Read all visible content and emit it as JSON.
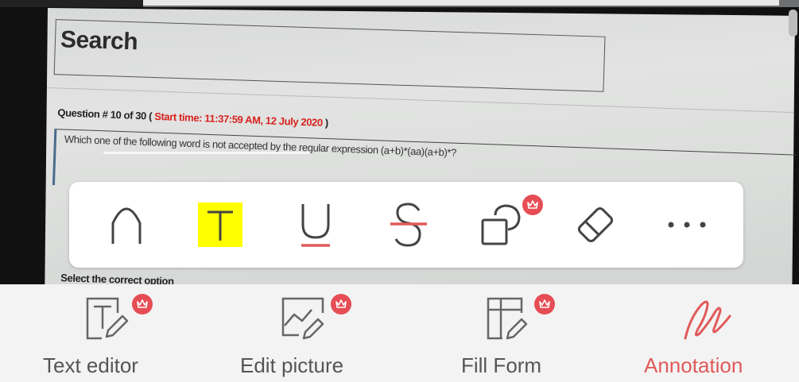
{
  "document": {
    "search_heading": "Search",
    "question_prefix": "Question # 10 of 30 (",
    "start_time": "Start time: 11:37:59 AM, 12 July 2020",
    "question_suffix": ")",
    "question_text": "Which one of the following word is not accepted by the regular expression (a+b)*(aa)(a+b)*?",
    "select_option": "Select the correct option"
  },
  "toolbar": {
    "tools": [
      {
        "name": "pen",
        "icon": "pen-nib-icon",
        "active": false,
        "premium": false
      },
      {
        "name": "highlight",
        "icon": "highlight-text-icon",
        "active": true,
        "premium": false
      },
      {
        "name": "underline",
        "icon": "underline-icon",
        "active": false,
        "premium": false
      },
      {
        "name": "strikethrough",
        "icon": "strikethrough-icon",
        "active": false,
        "premium": false
      },
      {
        "name": "shapes",
        "icon": "shapes-icon",
        "active": false,
        "premium": true
      },
      {
        "name": "eraser",
        "icon": "eraser-icon",
        "active": false,
        "premium": false
      },
      {
        "name": "more",
        "icon": "more-dots-icon",
        "active": false,
        "premium": false
      }
    ]
  },
  "bottom_nav": {
    "items": [
      {
        "label": "Text editor",
        "icon": "text-editor-icon",
        "premium": true,
        "active": false
      },
      {
        "label": "Edit picture",
        "icon": "edit-picture-icon",
        "premium": true,
        "active": false
      },
      {
        "label": "Fill Form",
        "icon": "fill-form-icon",
        "premium": true,
        "active": false
      },
      {
        "label": "Annotation",
        "icon": "annotation-squiggle-icon",
        "premium": false,
        "active": true
      }
    ]
  },
  "colors": {
    "accent": "#e05a5a",
    "badge": "#e64d55",
    "highlight": "#ffff00",
    "icon_gray": "#555555",
    "red_text": "#d8221d"
  }
}
